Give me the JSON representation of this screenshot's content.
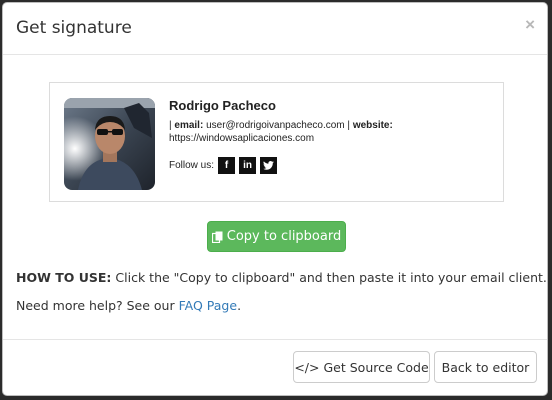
{
  "modal": {
    "title": "Get signature",
    "close_glyph": "×"
  },
  "signature": {
    "name": "Rodrigo Pacheco",
    "separator": "|",
    "email_label": "email:",
    "email_value": "user@rodrigoivanpacheco.com",
    "website_label": "website:",
    "website_value": "https://windowsaplicaciones.com",
    "follow_label": "Follow us:",
    "social": [
      {
        "icon": "facebook-icon",
        "glyph": "f"
      },
      {
        "icon": "linkedin-icon",
        "glyph": "in"
      },
      {
        "icon": "twitter-icon",
        "glyph": "🐦"
      }
    ]
  },
  "copy_button": {
    "label": "Copy to clipboard",
    "icon": "copy-icon",
    "color": "#5cb85c"
  },
  "instructions": {
    "howto_label": "HOW TO USE:",
    "howto_text": "Click the \"Copy to clipboard\" and then paste it into your email client.",
    "help_text": "Need more help? See our",
    "help_link": "FAQ Page",
    "help_suffix": "."
  },
  "footer": {
    "source_button": "Get Source Code",
    "source_icon": "</>",
    "back_button": "Back to editor"
  },
  "colors": {
    "link": "#337ab7",
    "success": "#5cb85c"
  }
}
